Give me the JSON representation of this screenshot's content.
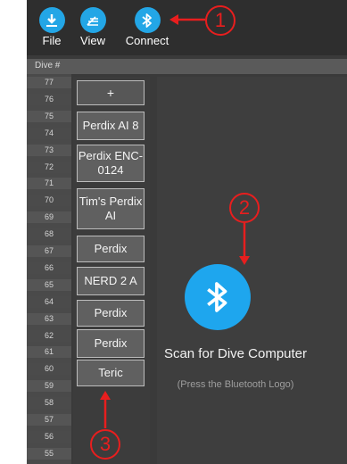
{
  "toolbar": {
    "file_label": "File",
    "view_label": "View",
    "connect_label": "Connect",
    "accent": "#23a6e6"
  },
  "dive_list": {
    "header": "Dive #",
    "numbers": [
      "77",
      "76",
      "75",
      "74",
      "73",
      "72",
      "71",
      "70",
      "69",
      "68",
      "67",
      "66",
      "65",
      "64",
      "63",
      "62",
      "61",
      "60",
      "59",
      "58",
      "57",
      "56",
      "55"
    ]
  },
  "devices": [
    {
      "label": "+"
    },
    {
      "label": "Perdix AI 8"
    },
    {
      "label": "Perdix ENC-0124"
    },
    {
      "label": "Tim's Perdix AI"
    },
    {
      "label": "Perdix"
    },
    {
      "label": "NERD 2 A"
    },
    {
      "label": "Perdix"
    },
    {
      "label": "Perdix"
    },
    {
      "label": "Teric"
    }
  ],
  "scan_panel": {
    "title": "Scan for Dive Computer",
    "hint": "(Press the Bluetooth Logo)"
  },
  "annotations": {
    "one": "1",
    "two": "2",
    "three": "3",
    "color": "#e81e1e"
  }
}
